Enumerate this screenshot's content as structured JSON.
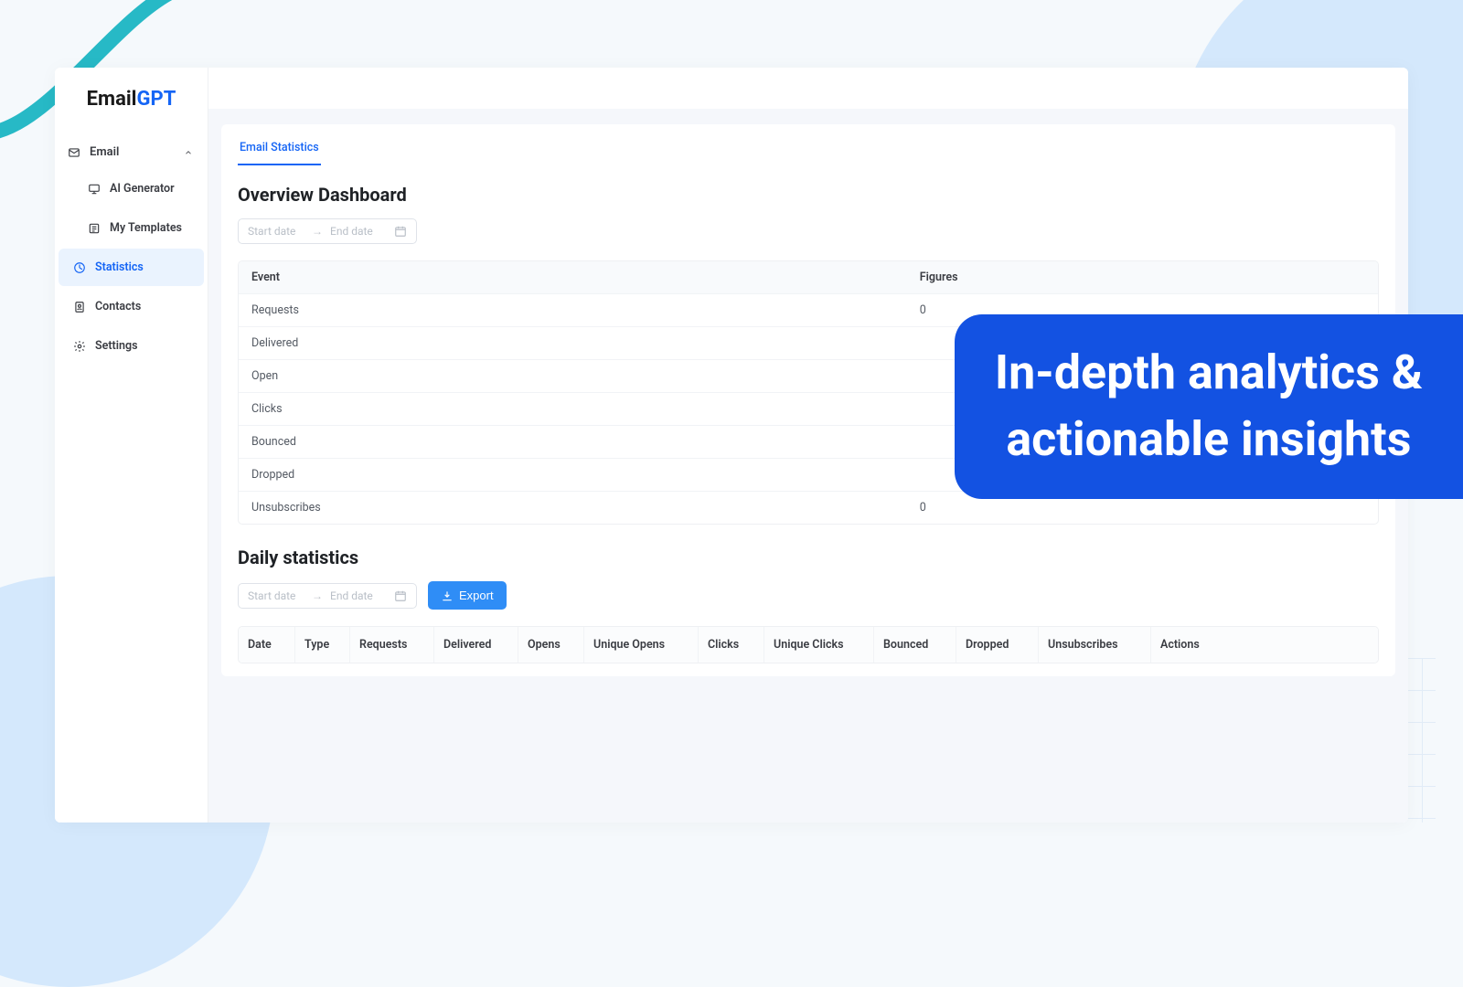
{
  "brand": {
    "part1": "Email",
    "part2": "GPT"
  },
  "sidebar": {
    "section_label": "Email",
    "items": [
      {
        "label": "AI Generator"
      },
      {
        "label": "My Templates"
      },
      {
        "label": "Statistics"
      },
      {
        "label": "Contacts"
      },
      {
        "label": "Settings"
      }
    ]
  },
  "tab": {
    "label": "Email Statistics"
  },
  "headings": {
    "overview": "Overview Dashboard",
    "daily": "Daily statistics"
  },
  "daterange": {
    "start_placeholder": "Start date",
    "end_placeholder": "End date"
  },
  "overview": {
    "header_event": "Event",
    "header_figures": "Figures",
    "rows": [
      {
        "event": "Requests",
        "figures": "0"
      },
      {
        "event": "Delivered",
        "figures": ""
      },
      {
        "event": "Open",
        "figures": ""
      },
      {
        "event": "Clicks",
        "figures": ""
      },
      {
        "event": "Bounced",
        "figures": ""
      },
      {
        "event": "Dropped",
        "figures": ""
      },
      {
        "event": "Unsubscribes",
        "figures": "0"
      }
    ]
  },
  "export_label": "Export",
  "daily": {
    "columns": {
      "date": "Date",
      "type": "Type",
      "requests": "Requests",
      "delivered": "Delivered",
      "opens": "Opens",
      "uopens": "Unique Opens",
      "clicks": "Clicks",
      "uclicks": "Unique Clicks",
      "bounced": "Bounced",
      "dropped": "Dropped",
      "unsubs": "Unsubscribes",
      "actions": "Actions"
    }
  },
  "callout": {
    "line1": "In-depth analytics &",
    "line2": "actionable insights"
  }
}
